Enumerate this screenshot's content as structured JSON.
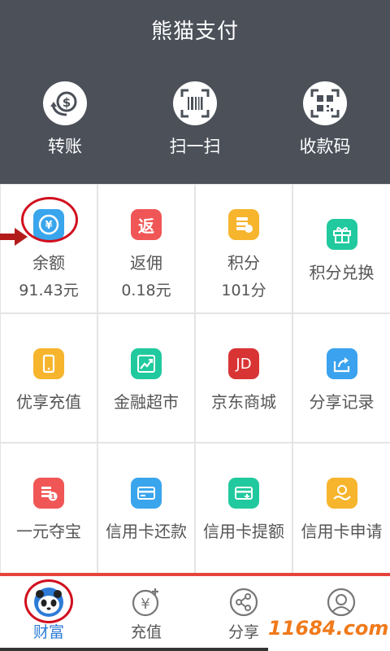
{
  "header": {
    "title": "熊猫支付",
    "actions": [
      {
        "label": "转账",
        "icon": "dollar-transfer-icon"
      },
      {
        "label": "扫一扫",
        "icon": "barcode-scan-icon"
      },
      {
        "label": "收款码",
        "icon": "qr-code-icon"
      }
    ]
  },
  "grid": {
    "items": [
      {
        "label": "余额",
        "value": "91.43元",
        "icon": "yen-coin-icon",
        "color": "#39a5ec"
      },
      {
        "label": "返佣",
        "value": "0.18元",
        "icon": "fan-rebate-icon",
        "color": "#f05656",
        "glyph": "返"
      },
      {
        "label": "积分",
        "value": "101分",
        "icon": "points-icon",
        "color": "#f6b52d"
      },
      {
        "label": "积分兑换",
        "icon": "gift-icon",
        "color": "#21c99e"
      },
      {
        "label": "优享充值",
        "icon": "phone-icon",
        "color": "#f6b52d"
      },
      {
        "label": "金融超市",
        "icon": "trend-chart-icon",
        "color": "#21c99e"
      },
      {
        "label": "京东商城",
        "icon": "jd-icon",
        "color": "#d93434",
        "glyph": "JD"
      },
      {
        "label": "分享记录",
        "icon": "share-record-icon",
        "color": "#3aa2ee"
      },
      {
        "label": "一元夺宝",
        "icon": "coin-stack-icon",
        "color": "#f05656"
      },
      {
        "label": "信用卡还款",
        "icon": "card-repay-icon",
        "color": "#39a5ec"
      },
      {
        "label": "信用卡提额",
        "icon": "card-limit-icon",
        "color": "#21c99e"
      },
      {
        "label": "信用卡申请",
        "icon": "card-apply-icon",
        "color": "#f6b52d"
      }
    ]
  },
  "tabbar": {
    "tabs": [
      {
        "label": "财富",
        "icon": "panda-avatar-icon",
        "active": true
      },
      {
        "label": "充值",
        "icon": "yen-plus-icon"
      },
      {
        "label": "分享",
        "icon": "share-icon"
      },
      {
        "label": "",
        "icon": "user-icon"
      }
    ]
  },
  "watermark": "11684.com",
  "colors": {
    "header_bg": "#4b5059",
    "accent_red": "#d10f1e",
    "active_tab": "#2d7bd6"
  }
}
